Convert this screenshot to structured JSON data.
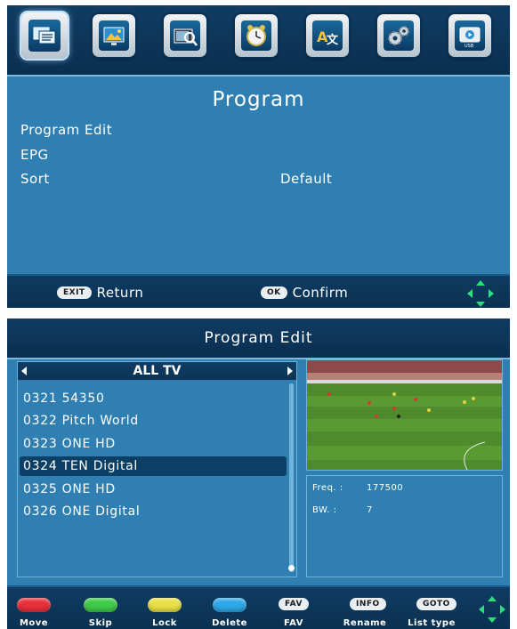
{
  "main_menu": {
    "icons": [
      {
        "name": "program-icon",
        "selected": true
      },
      {
        "name": "picture-icon",
        "selected": false
      },
      {
        "name": "channel-search-icon",
        "selected": false
      },
      {
        "name": "time-icon",
        "selected": false
      },
      {
        "name": "language-icon",
        "selected": false
      },
      {
        "name": "system-settings-icon",
        "selected": false
      },
      {
        "name": "usb-icon",
        "selected": false
      }
    ],
    "title": "Program",
    "items": [
      {
        "label": "Program Edit",
        "value": ""
      },
      {
        "label": "EPG",
        "value": ""
      },
      {
        "label": "Sort",
        "value": "Default"
      }
    ],
    "footer": {
      "exit_key": "EXIT",
      "exit_label": "Return",
      "ok_key": "OK",
      "ok_label": "Confirm"
    }
  },
  "program_edit": {
    "title": "Program Edit",
    "list_header": "ALL TV",
    "channels": [
      {
        "number": "0321",
        "name": "54350",
        "selected": false
      },
      {
        "number": "0322",
        "name": "Pitch World",
        "selected": false
      },
      {
        "number": "0323",
        "name": "ONE HD",
        "selected": false
      },
      {
        "number": "0324",
        "name": "TEN Digital",
        "selected": true
      },
      {
        "number": "0325",
        "name": "ONE HD",
        "selected": false
      },
      {
        "number": "0326",
        "name": "ONE Digital",
        "selected": false
      }
    ],
    "info": {
      "freq_label": "Freq. :",
      "freq_value": "177500",
      "bw_label": "BW. :",
      "bw_value": "7"
    },
    "footer": [
      {
        "key_type": "color",
        "color": "#e8303a",
        "label": "Move"
      },
      {
        "key_type": "color",
        "color": "#3fca4a",
        "label": "Skip"
      },
      {
        "key_type": "color",
        "color": "#e8e046",
        "label": "Lock"
      },
      {
        "key_type": "color",
        "color": "#2ea8e8",
        "label": "Delete"
      },
      {
        "key_type": "text",
        "key": "FAV",
        "label": "FAV"
      },
      {
        "key_type": "text",
        "key": "INFO",
        "label": "Rename"
      },
      {
        "key_type": "text",
        "key": "GOTO",
        "label": "List type"
      }
    ]
  },
  "colors": {
    "panel_bg": "#2f7fb2",
    "bar_bg": "#0f3c63",
    "selection": "#0c3f66",
    "nav_green": "#29e07a"
  }
}
